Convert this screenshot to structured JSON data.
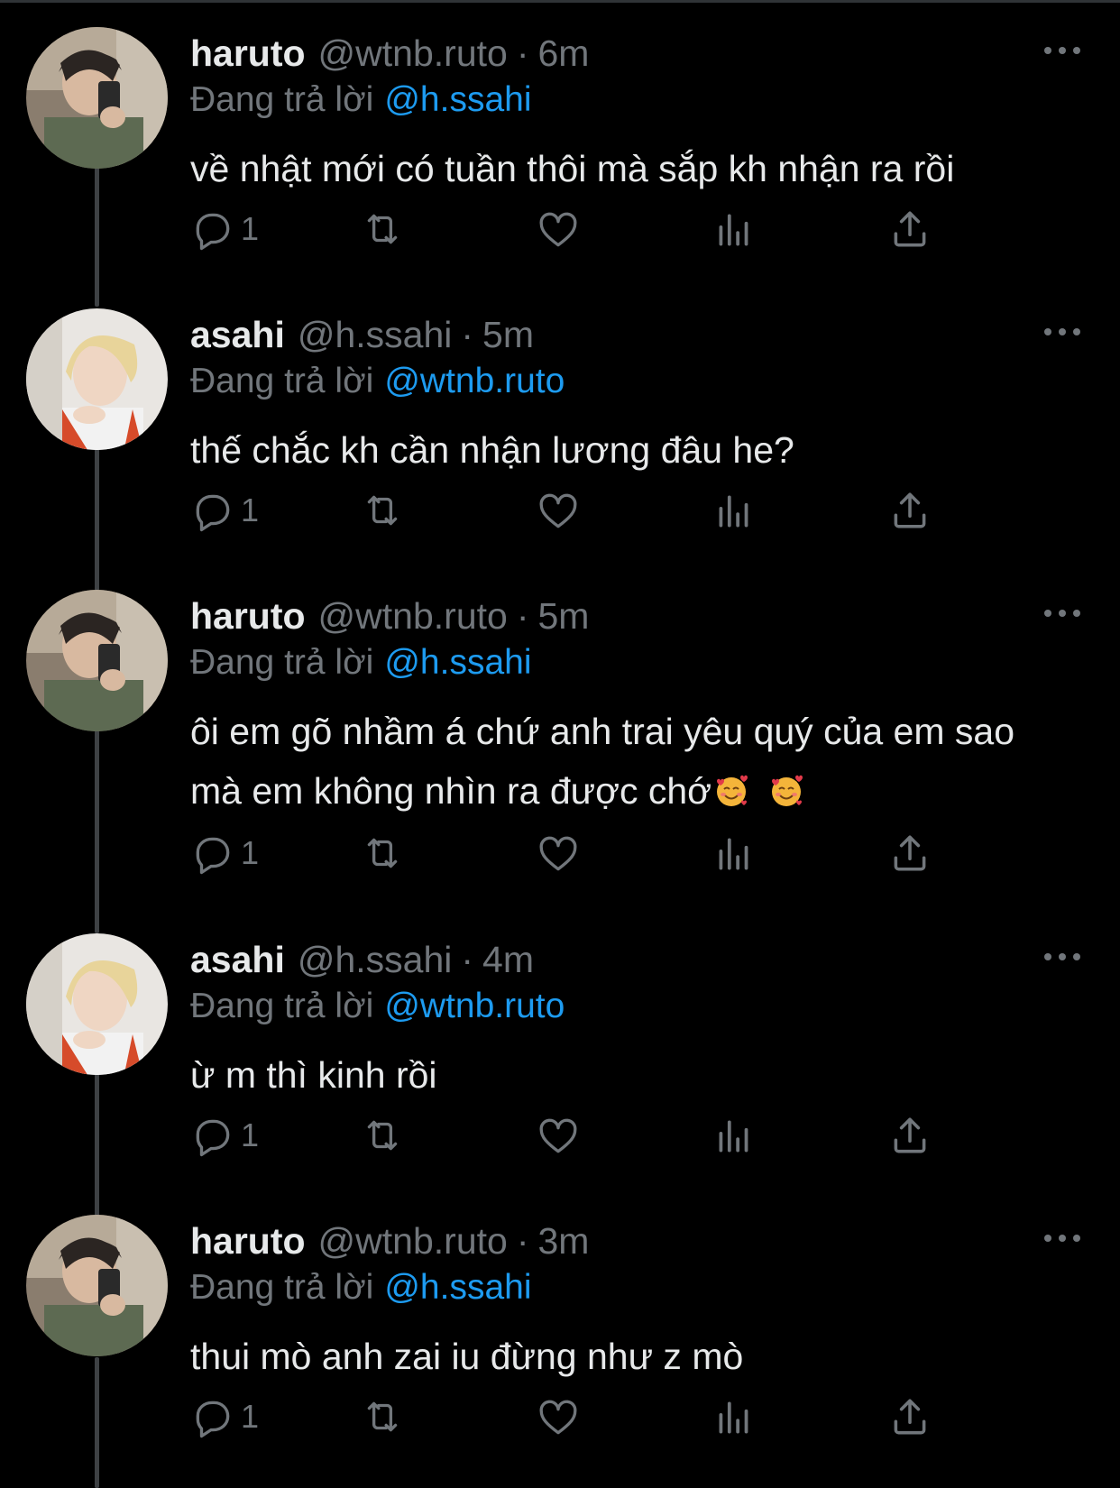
{
  "colors": {
    "background": "#000000",
    "text": "#e7e9ea",
    "muted": "#71767b",
    "link": "#1d9bf0",
    "thread_line": "#3e4144"
  },
  "reply_prefix": "Đang trả lời",
  "tweets": [
    {
      "name": "haruto",
      "handle": "@wtnb.ruto",
      "time": "6m",
      "reply_to": "@h.ssahi",
      "text_lines": [
        "về nhật mới có tuần thôi mà sắp kh nhận ra rồi"
      ],
      "reply_count": "1",
      "avatar": "avatar-haruto"
    },
    {
      "name": "asahi",
      "handle": "@h.ssahi",
      "time": "5m",
      "reply_to": "@wtnb.ruto",
      "text_lines": [
        "thế chắc kh cần nhận lương đâu he?"
      ],
      "reply_count": "1",
      "avatar": "avatar-asahi"
    },
    {
      "name": "haruto",
      "handle": "@wtnb.ruto",
      "time": "5m",
      "reply_to": "@h.ssahi",
      "text_lines": [
        "ôi em gõ nhầm á chứ anh trai yêu quý của em sao",
        "mà em không nhìn ra được chớ"
      ],
      "emojis": [
        "smiling-face-with-hearts-icon",
        "smiling-face-with-hearts-icon"
      ],
      "reply_count": "1",
      "avatar": "avatar-haruto"
    },
    {
      "name": "asahi",
      "handle": "@h.ssahi",
      "time": "4m",
      "reply_to": "@wtnb.ruto",
      "text_lines": [
        "ừ m thì kinh rồi"
      ],
      "reply_count": "1",
      "avatar": "avatar-asahi"
    },
    {
      "name": "haruto",
      "handle": "@wtnb.ruto",
      "time": "3m",
      "reply_to": "@h.ssahi",
      "text_lines": [
        "thui mò anh zai iu đừng như z mò"
      ],
      "reply_count": "1",
      "avatar": "avatar-haruto"
    }
  ],
  "icons": {
    "more": "more-icon",
    "reply": "reply-icon",
    "retweet": "retweet-icon",
    "like": "like-icon",
    "views": "views-icon",
    "share": "share-icon"
  }
}
